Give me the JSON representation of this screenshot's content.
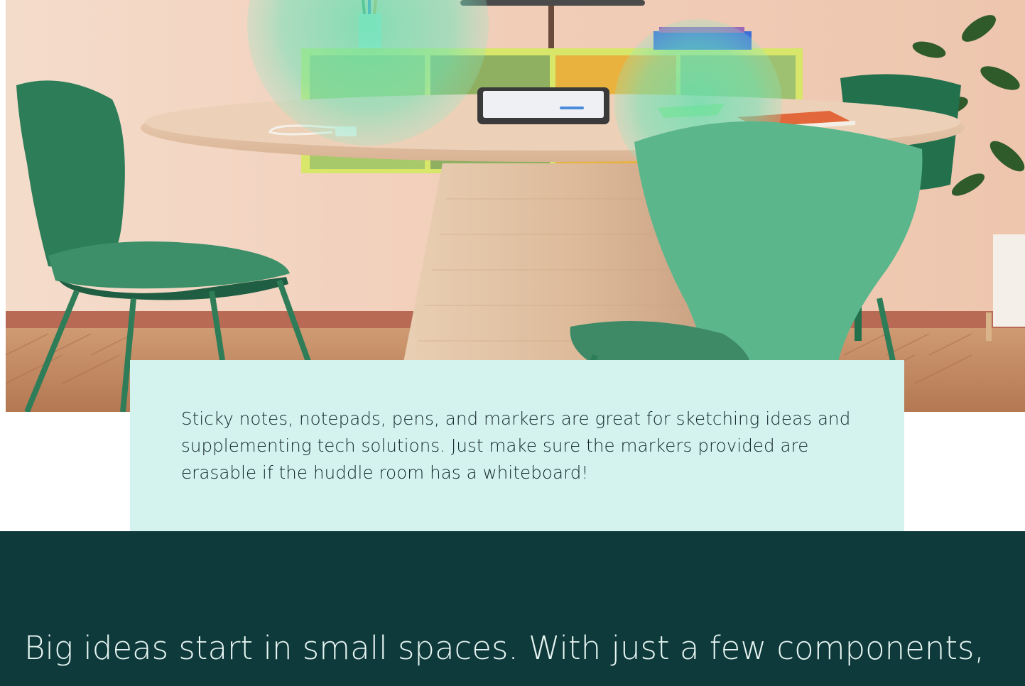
{
  "hero": {
    "palette": {
      "wall": "#f2d2bf",
      "floor": "#c98f66",
      "table": "#e7c9ae",
      "chair": "#2f8a65",
      "chair_light": "#5fbf94",
      "glow": "#7fe0b8"
    }
  },
  "caption": {
    "text": "Sticky notes, notepads, pens, and markers are great for sketching ideas and supplementing tech solutions. Just make sure the markers provided are erasable if the huddle room has a whiteboard!",
    "background": "#d5f3ee"
  },
  "section": {
    "heading": "Big ideas start in small spaces. With just a few components,",
    "background": "#0f3a3b"
  }
}
